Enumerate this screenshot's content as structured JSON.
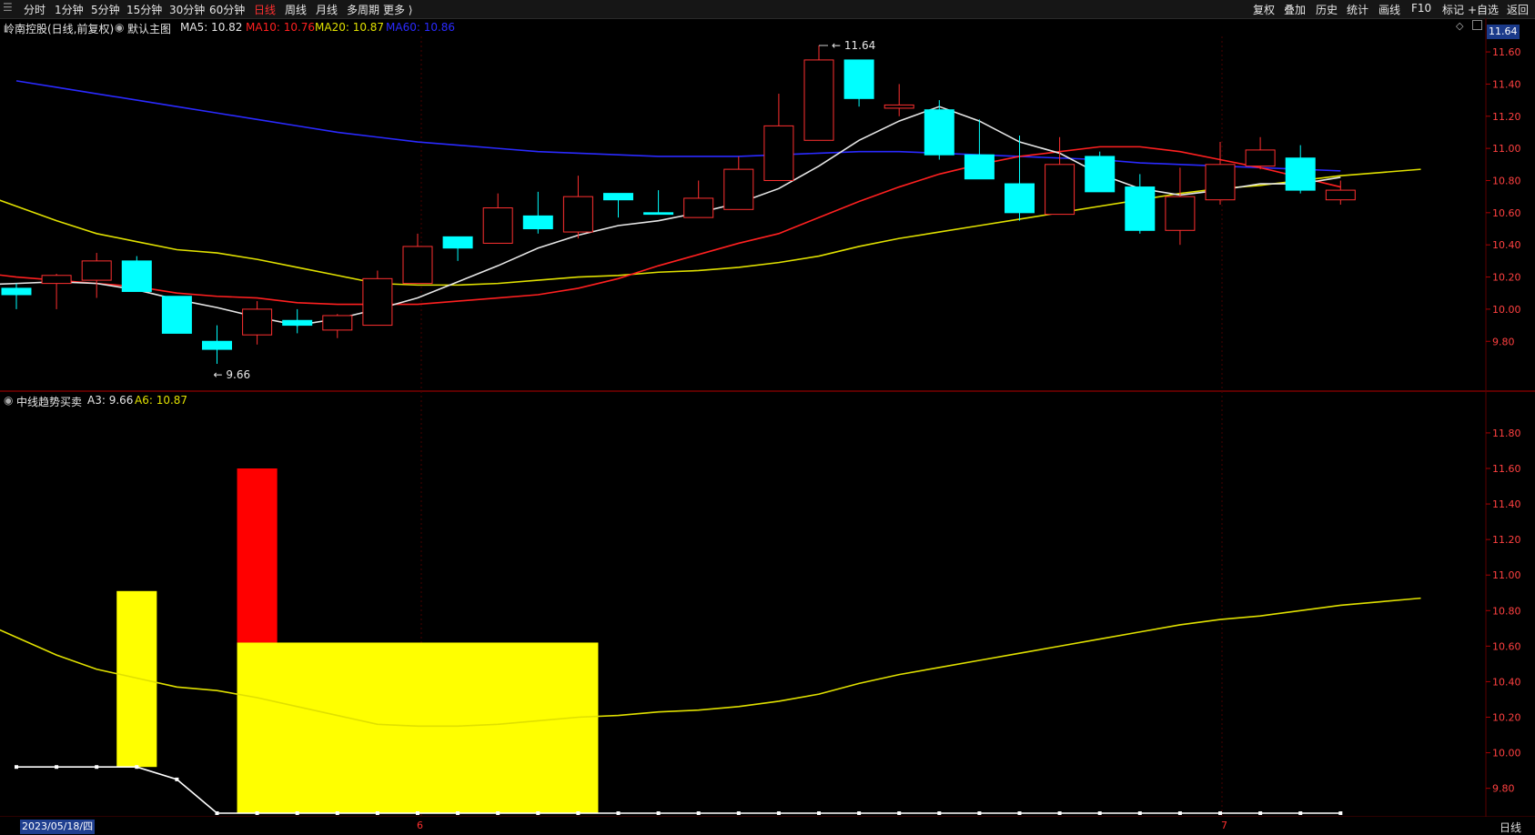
{
  "toolbar": {
    "menu_icon": "menu-icon",
    "periods": [
      "分时",
      "1分钟",
      "5分钟",
      "15分钟",
      "30分钟",
      "60分钟",
      "日线",
      "周线",
      "月线",
      "多周期",
      "更多 ⟩"
    ],
    "active_period": "日线",
    "right_buttons": [
      "复权",
      "叠加",
      "历史",
      "统计",
      "画线",
      "F10",
      "标记",
      "+自选",
      "返回"
    ]
  },
  "main_panel": {
    "stock_title": "岭南控股(日线,前复权)",
    "template": "默认主图",
    "ma_labels": [
      {
        "text": "MA5: 10.82",
        "color": "#e6e6e6"
      },
      {
        "text": "MA10: 10.76",
        "color": "#ff2020"
      },
      {
        "text": "MA20: 10.87",
        "color": "#e0e000"
      },
      {
        "text": "MA60: 10.86",
        "color": "#2a2aff"
      }
    ],
    "price_badge": "11.64",
    "high_marker": "11.64",
    "low_marker": "9.66",
    "y_ticks": [
      "11.60",
      "11.40",
      "11.20",
      "11.00",
      "10.80",
      "10.60",
      "10.40",
      "10.20",
      "10.00",
      "9.80"
    ]
  },
  "sub_panel": {
    "indicator_name": "中线趋势买卖",
    "a3_label": "A3: 9.66",
    "a6_label": "A6: 10.87",
    "y_ticks": [
      "11.80",
      "11.60",
      "11.40",
      "11.20",
      "11.00",
      "10.80",
      "10.60",
      "10.40",
      "10.20",
      "10.00",
      "9.80"
    ]
  },
  "status_bar": {
    "date": "2023/05/18/四",
    "month_marks": [
      "6",
      "7"
    ],
    "period_label": "日线"
  },
  "colors": {
    "up_candle": "#ff3030",
    "down_candle": "#00ffff",
    "ma5": "#e6e6e6",
    "ma10": "#ff2020",
    "ma20": "#e0e000",
    "ma60": "#2a2aff",
    "bar_yellow": "#ffff00",
    "bar_red": "#ff0000",
    "grid": "#4a0000"
  },
  "chart_data": {
    "type": "candlestick",
    "candles": [
      {
        "o": 10.13,
        "c": 10.09,
        "h": 10.16,
        "l": 10.0
      },
      {
        "o": 10.16,
        "c": 10.21,
        "h": 10.22,
        "l": 10.0
      },
      {
        "o": 10.18,
        "c": 10.3,
        "h": 10.35,
        "l": 10.07
      },
      {
        "o": 10.3,
        "c": 10.11,
        "h": 10.33,
        "l": 10.11
      },
      {
        "o": 10.08,
        "c": 9.85,
        "h": 10.08,
        "l": 9.85
      },
      {
        "o": 9.8,
        "c": 9.75,
        "h": 9.9,
        "l": 9.66
      },
      {
        "o": 9.84,
        "c": 10.0,
        "h": 10.05,
        "l": 9.78
      },
      {
        "o": 9.93,
        "c": 9.9,
        "h": 10.0,
        "l": 9.85
      },
      {
        "o": 9.87,
        "c": 9.96,
        "h": 9.97,
        "l": 9.82
      },
      {
        "o": 9.9,
        "c": 10.19,
        "h": 10.24,
        "l": 9.9
      },
      {
        "o": 10.16,
        "c": 10.39,
        "h": 10.47,
        "l": 10.16
      },
      {
        "o": 10.45,
        "c": 10.38,
        "h": 10.45,
        "l": 10.3
      },
      {
        "o": 10.41,
        "c": 10.63,
        "h": 10.72,
        "l": 10.41
      },
      {
        "o": 10.58,
        "c": 10.5,
        "h": 10.73,
        "l": 10.47
      },
      {
        "o": 10.48,
        "c": 10.7,
        "h": 10.83,
        "l": 10.44
      },
      {
        "o": 10.72,
        "c": 10.68,
        "h": 10.72,
        "l": 10.57
      },
      {
        "o": 10.6,
        "c": 10.59,
        "h": 10.74,
        "l": 10.59
      },
      {
        "o": 10.57,
        "c": 10.69,
        "h": 10.8,
        "l": 10.57
      },
      {
        "o": 10.62,
        "c": 10.87,
        "h": 10.95,
        "l": 10.62
      },
      {
        "o": 10.8,
        "c": 11.14,
        "h": 11.34,
        "l": 10.8
      },
      {
        "o": 11.05,
        "c": 11.55,
        "h": 11.64,
        "l": 11.05
      },
      {
        "o": 11.55,
        "c": 11.31,
        "h": 11.55,
        "l": 11.26
      },
      {
        "o": 11.25,
        "c": 11.27,
        "h": 11.4,
        "l": 11.2
      },
      {
        "o": 11.24,
        "c": 10.96,
        "h": 11.3,
        "l": 10.93
      },
      {
        "o": 10.96,
        "c": 10.81,
        "h": 11.18,
        "l": 10.81
      },
      {
        "o": 10.78,
        "c": 10.6,
        "h": 11.08,
        "l": 10.55
      },
      {
        "o": 10.59,
        "c": 10.9,
        "h": 11.07,
        "l": 10.59
      },
      {
        "o": 10.95,
        "c": 10.73,
        "h": 10.98,
        "l": 10.73
      },
      {
        "o": 10.76,
        "c": 10.49,
        "h": 10.84,
        "l": 10.47
      },
      {
        "o": 10.49,
        "c": 10.7,
        "h": 10.88,
        "l": 10.4
      },
      {
        "o": 10.68,
        "c": 10.9,
        "h": 11.04,
        "l": 10.65
      },
      {
        "o": 10.89,
        "c": 10.99,
        "h": 11.07,
        "l": 10.87
      },
      {
        "o": 10.94,
        "c": 10.74,
        "h": 11.02,
        "l": 10.72
      },
      {
        "o": 10.68,
        "c": 10.74,
        "h": 10.8,
        "l": 10.65
      }
    ],
    "ma5": [
      10.15,
      10.16,
      10.17,
      10.16,
      10.12,
      10.06,
      10.01,
      9.95,
      9.9,
      9.94,
      10.0,
      10.07,
      10.17,
      10.27,
      10.38,
      10.46,
      10.52,
      10.55,
      10.6,
      10.66,
      10.75,
      10.89,
      11.05,
      11.17,
      11.26,
      11.17,
      11.04,
      10.97,
      10.84,
      10.75,
      10.71,
      10.74,
      10.78,
      10.78,
      10.82
    ],
    "ma10": [
      10.23,
      10.2,
      10.18,
      10.16,
      10.14,
      10.1,
      10.08,
      10.07,
      10.04,
      10.03,
      10.03,
      10.03,
      10.05,
      10.07,
      10.09,
      10.13,
      10.19,
      10.27,
      10.34,
      10.41,
      10.47,
      10.57,
      10.67,
      10.76,
      10.84,
      10.9,
      10.95,
      10.98,
      11.01,
      11.01,
      10.98,
      10.93,
      10.88,
      10.82,
      10.76
    ],
    "ma20": [
      10.73,
      10.64,
      10.55,
      10.47,
      10.42,
      10.37,
      10.35,
      10.31,
      10.26,
      10.21,
      10.16,
      10.15,
      10.15,
      10.16,
      10.18,
      10.2,
      10.21,
      10.23,
      10.24,
      10.26,
      10.29,
      10.33,
      10.39,
      10.44,
      10.48,
      10.52,
      10.56,
      10.6,
      10.64,
      10.68,
      10.72,
      10.75,
      10.77,
      10.8,
      10.83,
      10.85,
      10.87
    ],
    "ma60": [
      11.42,
      11.38,
      11.34,
      11.3,
      11.26,
      11.22,
      11.18,
      11.14,
      11.1,
      11.07,
      11.04,
      11.02,
      11.0,
      10.98,
      10.97,
      10.96,
      10.95,
      10.95,
      10.95,
      10.96,
      10.97,
      10.98,
      10.98,
      10.97,
      10.96,
      10.95,
      10.94,
      10.93,
      10.91,
      10.9,
      10.89,
      10.88,
      10.87,
      10.86
    ],
    "sub_yellow_line": [
      10.75,
      10.65,
      10.55,
      10.47,
      10.42,
      10.37,
      10.35,
      10.31,
      10.26,
      10.21,
      10.16,
      10.15,
      10.15,
      10.16,
      10.18,
      10.2,
      10.21,
      10.23,
      10.24,
      10.26,
      10.29,
      10.33,
      10.39,
      10.44,
      10.48,
      10.52,
      10.56,
      10.6,
      10.64,
      10.68,
      10.72,
      10.75,
      10.77,
      10.8,
      10.83,
      10.85,
      10.87
    ],
    "sub_white_line": [
      9.92,
      9.92,
      9.92,
      9.92,
      9.85,
      9.66,
      9.66,
      9.66,
      9.66,
      9.66,
      9.66,
      9.66,
      9.66,
      9.66,
      9.66,
      9.66,
      9.66,
      9.66,
      9.66,
      9.66,
      9.66,
      9.66,
      9.66,
      9.66,
      9.66,
      9.66,
      9.66,
      9.66,
      9.66,
      9.66,
      9.66,
      9.66,
      9.66,
      9.66
    ],
    "sub_bars": [
      {
        "type": "yellow",
        "from_index": 2.5,
        "to_index": 3.5,
        "bottom": 9.92,
        "top": 10.91
      },
      {
        "type": "red",
        "from_index": 5.5,
        "to_index": 6.5,
        "bottom": 10.62,
        "top": 11.6
      },
      {
        "type": "yellow",
        "from_index": 5.5,
        "to_index": 14.5,
        "bottom": 9.66,
        "top": 10.62
      }
    ]
  }
}
